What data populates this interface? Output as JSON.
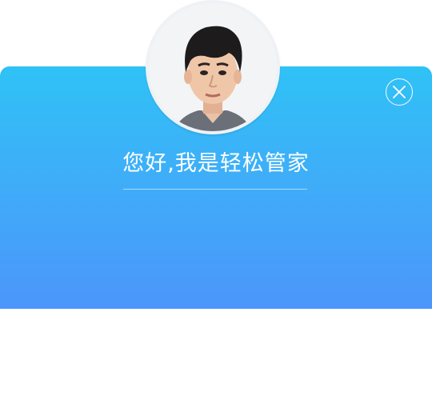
{
  "dialog": {
    "greeting": "您好,我是轻松管家",
    "avatar_icon": "person-avatar",
    "close_icon": "close-icon"
  },
  "colors": {
    "gradient_top": "#2fc2f6",
    "gradient_bottom": "#4c96fb",
    "text": "#ffffff"
  }
}
